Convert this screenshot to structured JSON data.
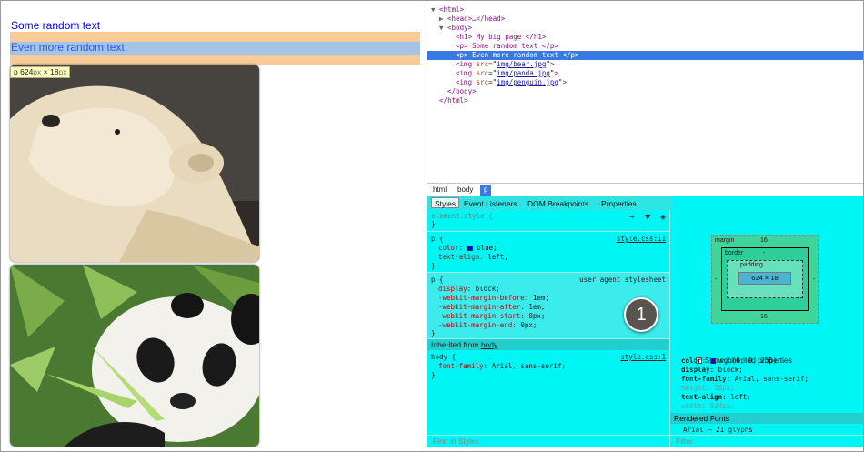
{
  "page": {
    "para1": "Some random text",
    "para2": "Even more random text",
    "tooltip": {
      "tag": "p",
      "width": "624",
      "height": "18",
      "unit": "px",
      "times": "×"
    }
  },
  "dom": {
    "lines": [
      {
        "indent": 0,
        "tri": "▼",
        "pre": "<",
        "tag": "html",
        "post": ">"
      },
      {
        "indent": 1,
        "tri": "▶",
        "pre": "<",
        "tag": "head",
        "post": ">…</head>"
      },
      {
        "indent": 1,
        "tri": "▼",
        "pre": "<",
        "tag": "body",
        "post": ">"
      },
      {
        "indent": 2,
        "tri": "",
        "pre": "<",
        "tag": "h1",
        "post": "> My big page </h1>"
      },
      {
        "indent": 2,
        "tri": "",
        "pre": "<",
        "tag": "p",
        "post": "> Some random text </p>"
      },
      {
        "indent": 2,
        "tri": "",
        "pre": "<",
        "tag": "p",
        "post": "> Even more random text </p>",
        "selected": true
      },
      {
        "indent": 2,
        "tri": "",
        "pre": "<",
        "tag": "img",
        "attr": "src",
        "val": "img/bear.jpg",
        "post": ">"
      },
      {
        "indent": 2,
        "tri": "",
        "pre": "<",
        "tag": "img",
        "attr": "src",
        "val": "img/panda.jpg",
        "post": ">"
      },
      {
        "indent": 2,
        "tri": "",
        "pre": "<",
        "tag": "img",
        "attr": "src",
        "val": "img/penguin.jpg",
        "post": ">"
      },
      {
        "indent": 1,
        "tri": "",
        "pre": "</",
        "tag": "body",
        "post": ">"
      },
      {
        "indent": 0,
        "tri": "",
        "pre": "</",
        "tag": "html",
        "post": ">"
      }
    ]
  },
  "breadcrumbs": [
    "html",
    "body",
    "p"
  ],
  "tabs": [
    "Styles",
    "Event Listeners",
    "DOM Breakpoints",
    "Properties"
  ],
  "styles": {
    "element_style": "element.style {",
    "icons": [
      "+",
      "📌",
      "◈"
    ],
    "rule1": {
      "selector": "p {",
      "source": "style.css:11",
      "color_prop": "color",
      "color_val": "blue;",
      "align_prop": "text-align",
      "align_val": "left;"
    },
    "ua": {
      "selector": "p {",
      "source": "user agent stylesheet",
      "decls": [
        {
          "prop": "display",
          "val": "block;"
        },
        {
          "prop": "-webkit-margin-before",
          "val": "1em;"
        },
        {
          "prop": "-webkit-margin-after",
          "val": "1em;"
        },
        {
          "prop": "-webkit-margin-start",
          "val": "0px;"
        },
        {
          "prop": "-webkit-margin-end",
          "val": "0px;"
        }
      ]
    },
    "inherited_label": "Inherited from",
    "inherited_from": "body",
    "body_rule": {
      "selector": "body {",
      "source": "style.css:1",
      "prop": "font-family",
      "val": "Arial, sans-serif;"
    },
    "find_placeholder": "Find in Styles"
  },
  "metrics": {
    "margin_label": "margin",
    "margin_top": "16",
    "margin_bottom": "16",
    "margin_side": "-",
    "border_label": "border",
    "border_val": "-",
    "padding_label": "padding",
    "padding_val": "-",
    "content": "624 × 18"
  },
  "computed": {
    "show_inherited": "Show inherited properties",
    "lines": [
      {
        "prop": "color",
        "val": "rgb(0, 0, 255);",
        "swatch": true
      },
      {
        "prop": "display",
        "val": "block;"
      },
      {
        "prop": "font-family",
        "val": "Arial, sans-serif;"
      },
      {
        "prop": "height",
        "val": "18px;",
        "dim": true
      },
      {
        "prop": "text-align",
        "val": "left;"
      },
      {
        "prop": "width",
        "val": "624px;",
        "dim": true
      }
    ],
    "rendered_fonts": "Rendered Fonts",
    "font_line": "Arial — 21 glyphs",
    "filter_placeholder": "Filter"
  },
  "badge": "1"
}
